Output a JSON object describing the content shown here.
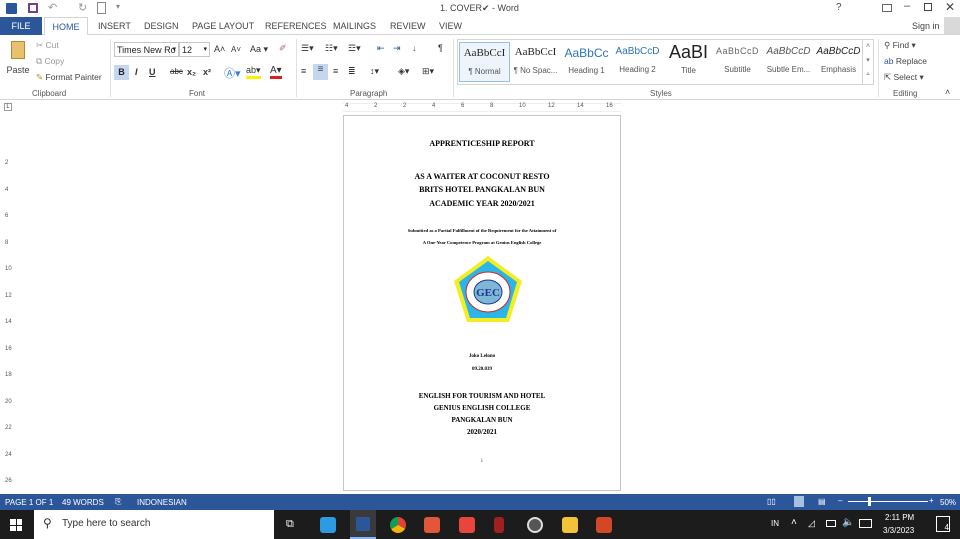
{
  "window": {
    "title": "1. COVER✔ - Word",
    "help": "?",
    "sign_in": "Sign in"
  },
  "tabs": [
    "FILE",
    "HOME",
    "INSERT",
    "DESIGN",
    "PAGE LAYOUT",
    "REFERENCES",
    "MAILINGS",
    "REVIEW",
    "VIEW"
  ],
  "clipboard": {
    "paste": "Paste",
    "cut": "Cut",
    "copy": "Copy",
    "format_painter": "Format Painter",
    "label": "Clipboard"
  },
  "font": {
    "name": "Times New Ro",
    "size": "12",
    "label": "Font",
    "bold": "B",
    "italic": "I",
    "underline": "U",
    "strike": "abc",
    "sub": "x₂",
    "sup": "x²",
    "change_case": "Aa"
  },
  "paragraph": {
    "label": "Paragraph"
  },
  "styles": {
    "label": "Styles",
    "items": [
      {
        "preview": "AaBbCcI",
        "name": "¶ Normal"
      },
      {
        "preview": "AaBbCcI",
        "name": "¶ No Spac..."
      },
      {
        "preview": "AaBbCc",
        "name": "Heading 1"
      },
      {
        "preview": "AaBbCcD",
        "name": "Heading 2"
      },
      {
        "preview": "AaBI",
        "name": "Title"
      },
      {
        "preview": "AaBbCcD",
        "name": "Subtitle"
      },
      {
        "preview": "AaBbCcD",
        "name": "Subtle Em..."
      },
      {
        "preview": "AaBbCcD",
        "name": "Emphasis"
      }
    ]
  },
  "editing": {
    "label": "Editing",
    "find": "Find",
    "replace": "Replace",
    "select": "Select"
  },
  "ruler": {
    "h": [
      "4",
      "2",
      "2",
      "4",
      "6",
      "8",
      "10",
      "12",
      "14",
      "16"
    ],
    "v": [
      "2",
      "4",
      "6",
      "8",
      "10",
      "12",
      "14",
      "16",
      "18",
      "20",
      "22",
      "24",
      "26"
    ]
  },
  "document": {
    "title": "APPRENTICESHIP REPORT",
    "subtitle": [
      "AS A WAITER AT COCONUT RESTO",
      "BRITS HOTEL PANGKALAN BUN",
      "ACADEMIC YEAR 2020/2021"
    ],
    "submitted": [
      "Submitted as a Partial Fulfillment of the Requirement for the Attainment of",
      "A One-Year Competence Program at Genius English College"
    ],
    "logo_text": "GEC",
    "logo_ring": "GENIUS ENGLISH COLLEGE PANGKALAN BUN",
    "author": "Joko Lelono",
    "student_id": "09.20.039",
    "institution": [
      "ENGLISH FOR TOURISM AND HOTEL",
      "GENIUS ENGLISH COLLEGE",
      "PANGKALAN BUN",
      "2020/2021"
    ],
    "page_number": "i"
  },
  "status": {
    "page": "PAGE 1 OF 1",
    "words": "49 WORDS",
    "language": "INDONESIAN",
    "zoom": "50%",
    "zoom_fraction": 0.5
  },
  "taskbar": {
    "search_placeholder": "Type here to search",
    "lang": "IN",
    "time": "2:11 PM",
    "date": "3/3/2023",
    "notifications": "4"
  },
  "colors": {
    "accent": "#2b579a",
    "taskbar": "#1c1c1c"
  }
}
